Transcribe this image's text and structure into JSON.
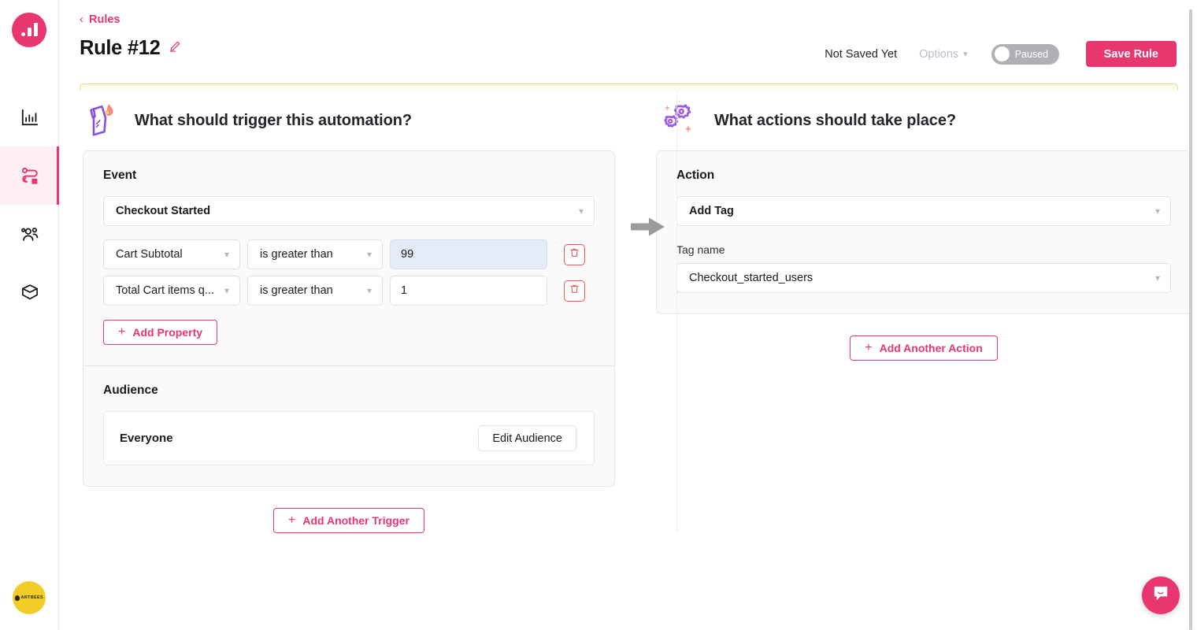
{
  "app": {
    "logo_icon": "bar-chart-logo",
    "accent_color": "#e8366f",
    "trigger_icon_color": "#9b59e8",
    "avatar_text": "ARTBEES"
  },
  "sidebar": {
    "items": [
      {
        "name": "analytics",
        "icon": "bar-chart-icon",
        "active": false
      },
      {
        "name": "rules",
        "icon": "rules-flow-icon",
        "active": true
      },
      {
        "name": "audience",
        "icon": "people-icon",
        "active": false
      },
      {
        "name": "products",
        "icon": "box-icon",
        "active": false
      }
    ]
  },
  "header": {
    "back_label": "Rules",
    "back_icon": "chevron-left-icon",
    "title": "Rule #12",
    "edit_icon": "pencil-icon",
    "save_status": "Not Saved Yet",
    "options_label": "Options",
    "options_icon": "chevron-down-icon",
    "toggle_label": "Paused",
    "toggle_on": false,
    "save_button": "Save Rule"
  },
  "trigger": {
    "section_icon": "lighter-flame-icon",
    "section_title": "What should trigger this automation?",
    "event": {
      "pane_title": "Event",
      "selected": "Checkout Started",
      "properties": [
        {
          "name": "Cart Subtotal",
          "operator": "is greater than",
          "value": "99",
          "focused": true,
          "delete_icon": "trash-icon"
        },
        {
          "name": "Total Cart items q...",
          "operator": "is greater than",
          "value": "1",
          "focused": false,
          "delete_icon": "trash-icon"
        }
      ],
      "add_property_label": "Add Property"
    },
    "audience": {
      "pane_title": "Audience",
      "value": "Everyone",
      "edit_button": "Edit Audience"
    },
    "add_trigger_label": "Add Another Trigger"
  },
  "flow": {
    "arrow_icon": "arrow-right-icon"
  },
  "actions": {
    "section_icon": "gears-sparkle-icon",
    "section_title": "What actions should take place?",
    "action": {
      "pane_title": "Action",
      "selected": "Add Tag",
      "tag_name_label": "Tag name",
      "tag_name_value": "Checkout_started_users"
    },
    "add_action_label": "Add Another Action"
  },
  "widgets": {
    "chat_icon": "chat-bubble-icon"
  }
}
